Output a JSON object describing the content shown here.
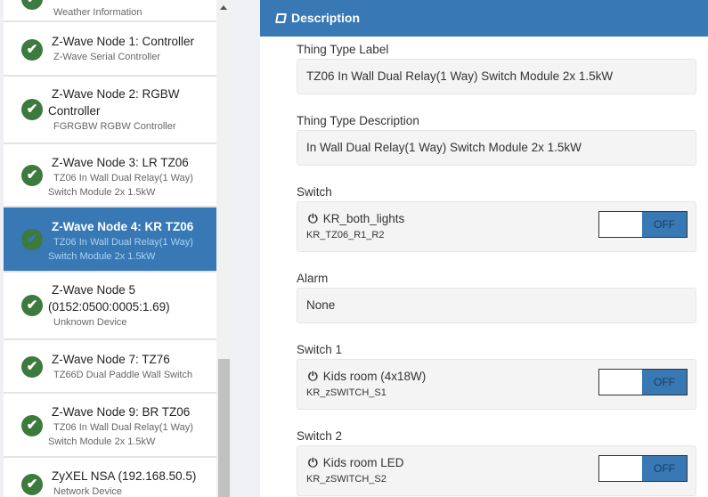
{
  "sidebar": {
    "items": [
      {
        "title": "",
        "subtitle": "Weather Information",
        "selected": false
      },
      {
        "title": "Z-Wave Node 1: Controller",
        "subtitle": "Z-Wave Serial Controller",
        "selected": false
      },
      {
        "title": "Z-Wave Node 2: RGBW Controller",
        "subtitle": "FGRGBW RGBW Controller",
        "selected": false
      },
      {
        "title": "Z-Wave Node 3: LR TZ06",
        "subtitle": "TZ06 In Wall Dual Relay(1 Way) Switch Module 2x 1.5kW",
        "selected": false
      },
      {
        "title": "Z-Wave Node 4: KR TZ06",
        "subtitle": "TZ06 In Wall Dual Relay(1 Way) Switch Module 2x 1.5kW",
        "selected": true
      },
      {
        "title": "Z-Wave Node 5 (0152:0500:0005:1.69)",
        "subtitle": "Unknown Device",
        "selected": false
      },
      {
        "title": "Z-Wave Node 7: TZ76",
        "subtitle": "TZ66D Dual Paddle Wall Switch",
        "selected": false
      },
      {
        "title": "Z-Wave Node 9: BR TZ06",
        "subtitle": "TZ06 In Wall Dual Relay(1 Way) Switch Module 2x 1.5kW",
        "selected": false
      },
      {
        "title": "ZyXEL NSA (192.168.50.5)",
        "subtitle": "Network Device",
        "selected": false
      }
    ]
  },
  "panel": {
    "title": "Description",
    "thing_type_label": {
      "label": "Thing Type Label",
      "value": "TZ06 In Wall Dual Relay(1 Way) Switch Module 2x 1.5kW"
    },
    "thing_type_description": {
      "label": "Thing Type Description",
      "value": "In Wall Dual Relay(1 Way) Switch Module 2x 1.5kW"
    },
    "switch": {
      "label": "Switch",
      "name": "KR_both_lights",
      "id": "KR_TZ06_R1_R2",
      "state": "OFF"
    },
    "alarm": {
      "label": "Alarm",
      "value": "None"
    },
    "switch1": {
      "label": "Switch 1",
      "name": "Kids room (4x18W)",
      "id": "KR_zSWITCH_S1",
      "state": "OFF"
    },
    "switch2": {
      "label": "Switch 2",
      "name": "Kids room LED",
      "id": "KR_zSWITCH_S2",
      "state": "OFF"
    }
  },
  "colors": {
    "accent": "#3778b5",
    "check": "#3c7a3e"
  }
}
